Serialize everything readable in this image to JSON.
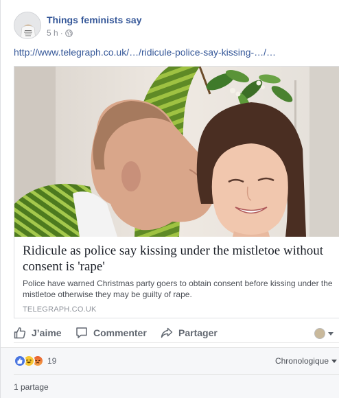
{
  "post": {
    "page_name": "Things feminists say",
    "timestamp": "5 h",
    "separator": "·",
    "privacy_icon": "globe-icon",
    "link_url": "http://www.telegraph.co.uk/…/ridicule-police-say-kissing-…/…"
  },
  "attachment": {
    "title": "Ridicule as police say kissing under the mistletoe without consent is 'rape'",
    "description": "Police have warned Christmas party goers to obtain consent before kissing under the mistletoe otherwise they may be guilty of rape.",
    "domain": "TELEGRAPH.CO.UK"
  },
  "actions": {
    "like": "J’aime",
    "comment": "Commenter",
    "share": "Partager"
  },
  "feedback": {
    "reaction_count": "19",
    "reactions": [
      "like-icon",
      "haha-icon",
      "angry-icon"
    ],
    "sort_label": "Chronologique",
    "shares": "1 partage"
  },
  "colors": {
    "link_blue": "#365899",
    "text_gray": "#616770",
    "feedback_bg": "#f6f7f9"
  }
}
